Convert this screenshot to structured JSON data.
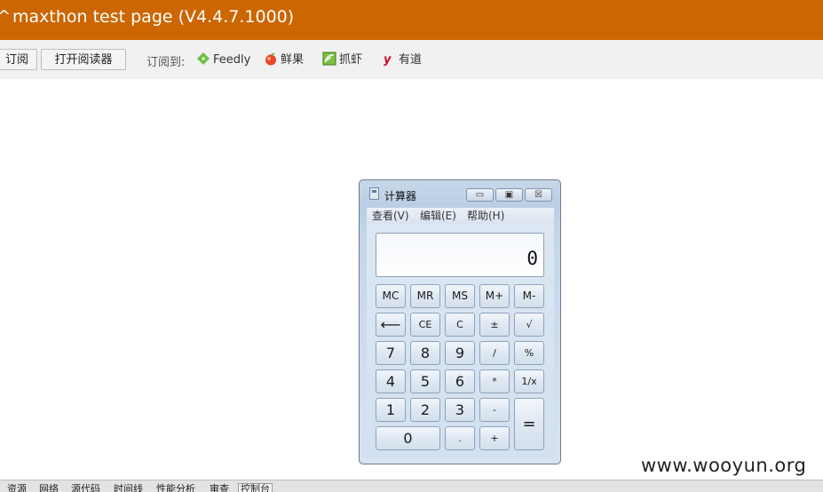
{
  "topbar": {
    "logo": "^",
    "title": "maxthon test page (V4.4.7.1000)",
    "bg_color": "#cc6600"
  },
  "toolbar": {
    "subscribe_label": "订阅",
    "open_reader_label": "打开阅读器",
    "subscribe_to_label": "订阅到:",
    "services": [
      {
        "name": "Feedly",
        "icon": "feedly-icon"
      },
      {
        "name": "鲜果",
        "icon": "xianguo-icon"
      },
      {
        "name": "抓虾",
        "icon": "zhuaxia-icon"
      },
      {
        "name": "有道",
        "icon": "youdao-icon"
      }
    ]
  },
  "calculator": {
    "title": "计算器",
    "menu": [
      "查看(V)",
      "编辑(E)",
      "帮助(H)"
    ],
    "display": "0",
    "window_buttons": {
      "minimize": "▭",
      "maximize": "▣",
      "close": "☒"
    },
    "keys": {
      "mc": "MC",
      "mr": "MR",
      "ms": "MS",
      "mplus": "M+",
      "mminus": "M-",
      "back": "⟵",
      "ce": "CE",
      "c": "C",
      "sign": "±",
      "sqrt": "√",
      "d7": "7",
      "d8": "8",
      "d9": "9",
      "div": "/",
      "pct": "%",
      "d4": "4",
      "d5": "5",
      "d6": "6",
      "mul": "*",
      "recip": "1/x",
      "d1": "1",
      "d2": "2",
      "d3": "3",
      "sub": "-",
      "eq": "=",
      "d0": "0",
      "dot": ".",
      "add": "+"
    }
  },
  "devbar": {
    "tabs": [
      "资源",
      "网络",
      "源代码",
      "时间线",
      "性能分析",
      "审查",
      "控制台"
    ],
    "active": "控制台"
  },
  "watermark": "www.wooyun.org"
}
